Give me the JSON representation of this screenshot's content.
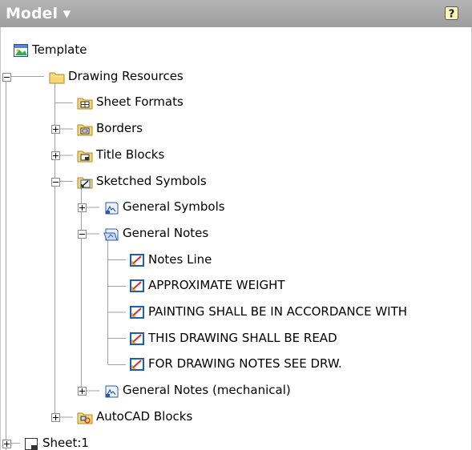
{
  "panel": {
    "title": "Model ▾",
    "help_icon": "help-icon",
    "help_glyph": "?"
  },
  "tree": {
    "nodes": [
      {
        "label": "Template",
        "icon": "template-icon"
      },
      {
        "label": "Drawing Resources",
        "icon": "folder-icon",
        "expander": "minus"
      },
      {
        "label": "Sheet Formats",
        "icon": "sheet-formats-icon"
      },
      {
        "label": "Borders",
        "icon": "borders-icon",
        "expander": "plus"
      },
      {
        "label": "Title Blocks",
        "icon": "title-blocks-icon",
        "expander": "plus"
      },
      {
        "label": "Sketched Symbols",
        "icon": "sketched-symbols-icon",
        "expander": "minus"
      },
      {
        "label": "General Symbols",
        "icon": "symbol-library-icon",
        "expander": "plus"
      },
      {
        "label": "General Notes",
        "icon": "symbol-library-open-icon",
        "expander": "minus"
      },
      {
        "label": "Notes Line",
        "icon": "sketched-symbol-icon"
      },
      {
        "label": "APPROXIMATE WEIGHT",
        "icon": "sketched-symbol-icon"
      },
      {
        "label": "PAINTING SHALL BE IN ACCORDANCE WITH",
        "icon": "sketched-symbol-icon"
      },
      {
        "label": "THIS DRAWING SHALL BE READ",
        "icon": "sketched-symbol-icon"
      },
      {
        "label": "FOR DRAWING NOTES SEE DRW.",
        "icon": "sketched-symbol-icon"
      },
      {
        "label": "General Notes (mechanical)",
        "icon": "symbol-library-icon",
        "expander": "plus"
      },
      {
        "label": "AutoCAD Blocks",
        "icon": "autocad-blocks-icon",
        "expander": "plus"
      },
      {
        "label": "Sheet:1",
        "icon": "sheet-icon",
        "expander": "plus"
      }
    ]
  },
  "colors": {
    "title_bar": "#a9a9a9",
    "tree_line": "#a0a0a0",
    "folder_yellow": "#f5d77a",
    "symbol_blue": "#1b5fb0",
    "symbol_red": "#d93020"
  }
}
